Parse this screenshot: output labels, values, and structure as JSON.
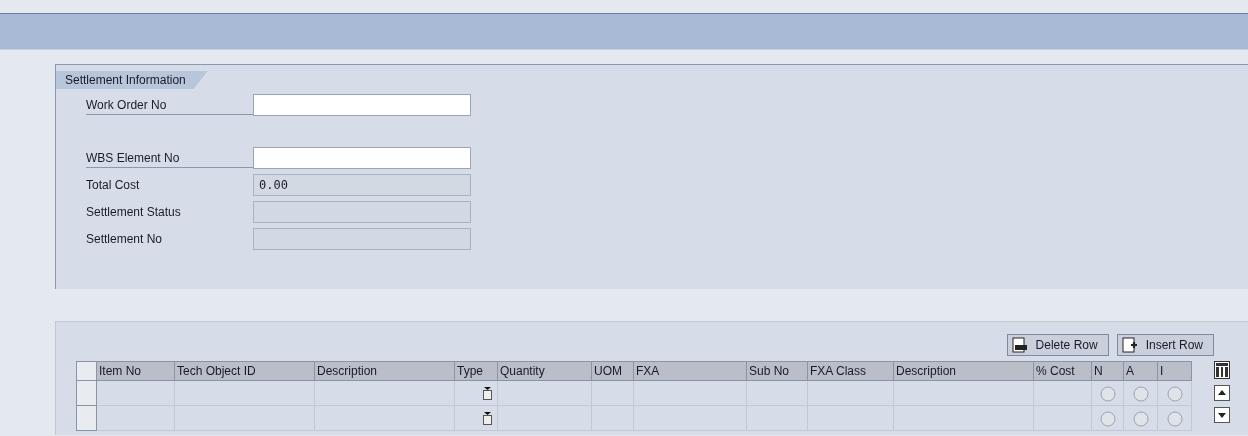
{
  "group": {
    "title": "Settlement Information",
    "fields": [
      {
        "label": "Work Order No",
        "disabled": false
      },
      {
        "label": "WBS Element No",
        "disabled": false
      },
      {
        "label": "Total Cost",
        "value": "0.00",
        "disabled": true
      },
      {
        "label": "Settlement Status",
        "disabled": true
      },
      {
        "label": "Settlement No",
        "disabled": true
      }
    ]
  },
  "toolbar": {
    "buttons": [
      {
        "label": "Delete Row",
        "kind": "delete"
      },
      {
        "label": "Insert Row",
        "kind": "insert"
      }
    ]
  },
  "table": {
    "columns": [
      {
        "label": "Item No",
        "kind": "text"
      },
      {
        "label": "Tech Object ID",
        "kind": "text"
      },
      {
        "label": "Description",
        "kind": "text"
      },
      {
        "label": "Type",
        "kind": "dropdown"
      },
      {
        "label": "Quantity",
        "kind": "text"
      },
      {
        "label": "UOM",
        "kind": "text"
      },
      {
        "label": "FXA",
        "kind": "text"
      },
      {
        "label": "Sub No",
        "kind": "text"
      },
      {
        "label": "FXA Class",
        "kind": "text"
      },
      {
        "label": "Description",
        "kind": "text"
      },
      {
        "label": "% Cost",
        "kind": "text"
      },
      {
        "label": "N",
        "kind": "radio"
      },
      {
        "label": "A",
        "kind": "radio"
      },
      {
        "label": "I",
        "kind": "radio"
      }
    ],
    "rows": [
      {
        "n": false,
        "a": false,
        "i": false
      },
      {
        "n": false,
        "a": false,
        "i": false
      }
    ]
  }
}
